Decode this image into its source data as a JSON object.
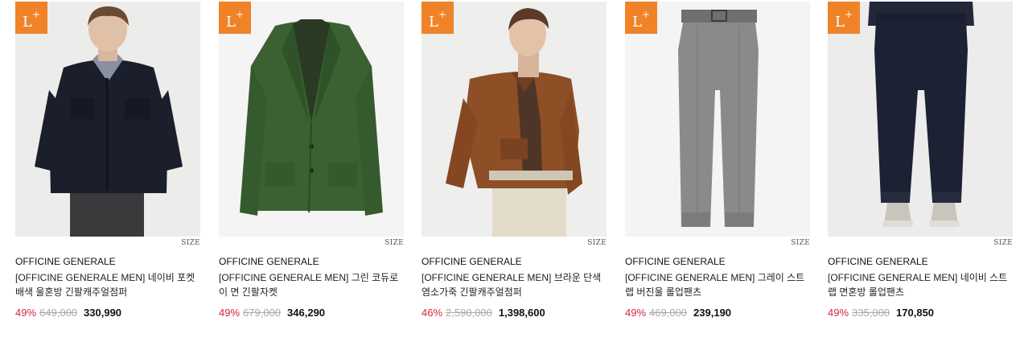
{
  "products": [
    {
      "badge": "L",
      "badge_sup": "+",
      "size_label": "SIZE",
      "brand": "OFFICINE GENERALE",
      "name": "[OFFICINE GENERALE MEN] 네이비 포켓 배색 울혼방 긴팔캐주얼점퍼",
      "discount": "49%",
      "original_price": "649,000",
      "price": "330,990",
      "image_subject": "navy-wool-jacket-model"
    },
    {
      "badge": "L",
      "badge_sup": "+",
      "size_label": "SIZE",
      "brand": "OFFICINE GENERALE",
      "name": "[OFFICINE GENERALE MEN] 그린 코듀로이 면 긴팔자켓",
      "discount": "49%",
      "original_price": "679,000",
      "price": "346,290",
      "image_subject": "green-corduroy-blazer"
    },
    {
      "badge": "L",
      "badge_sup": "+",
      "size_label": "SIZE",
      "brand": "OFFICINE GENERALE",
      "name": "[OFFICINE GENERALE MEN] 브라운 단색 염소가죽 긴팔캐주얼점퍼",
      "discount": "46%",
      "original_price": "2,590,000",
      "price": "1,398,600",
      "image_subject": "brown-suede-jacket-model"
    },
    {
      "badge": "L",
      "badge_sup": "+",
      "size_label": "SIZE",
      "brand": "OFFICINE GENERALE",
      "name": "[OFFICINE GENERALE MEN] 그레이 스트랩 버진울 롤업팬츠",
      "discount": "49%",
      "original_price": "469,000",
      "price": "239,190",
      "image_subject": "gray-wool-trousers"
    },
    {
      "badge": "L",
      "badge_sup": "+",
      "size_label": "SIZE",
      "brand": "OFFICINE GENERALE",
      "name": "[OFFICINE GENERALE MEN] 네이비 스트랩 면혼방 롤업팬츠",
      "discount": "49%",
      "original_price": "335,000",
      "price": "170,850",
      "image_subject": "navy-cotton-trousers-model"
    }
  ],
  "colors": {
    "badge": "#f08328",
    "discount": "#d6263b",
    "original_price": "#aaaaaa",
    "image_bg": "#eeeeee"
  }
}
